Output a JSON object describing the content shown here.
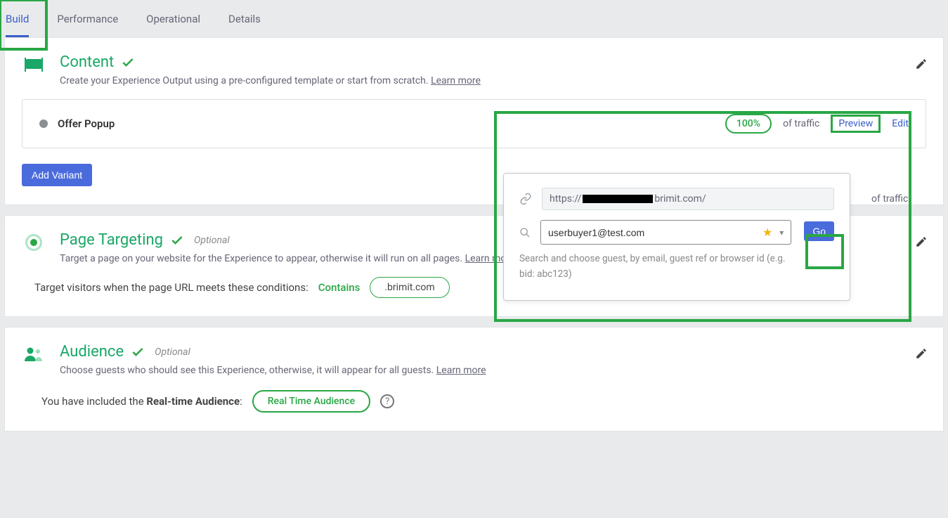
{
  "tabs": {
    "build": "Build",
    "performance": "Performance",
    "operational": "Operational",
    "details": "Details"
  },
  "content": {
    "title": "Content",
    "subtitle": "Create your Experience Output using a pre-configured template or start from scratch.",
    "learn_more": "Learn more",
    "variant_name": "Offer Popup",
    "traffic_pct": "100%",
    "of_traffic": "of traffic",
    "preview": "Preview",
    "edit": "Edit",
    "add_variant": "Add Variant"
  },
  "preview_popup": {
    "url_prefix": "https://",
    "url_suffix": "brimit.com/",
    "guest_value": "userbuyer1@test.com",
    "help_text": "Search and choose guest, by email, guest ref or browser id (e.g. bid: abc123)",
    "go": "Go"
  },
  "targeting": {
    "title": "Page Targeting",
    "optional": "Optional",
    "subtitle": "Target a page on your website for the Experience to appear, otherwise it will run on all pages.",
    "learn_more": "Learn more",
    "body_prefix": "Target visitors when the page URL meets these conditions:",
    "contains_label": "Contains",
    "contains_value": ".brimit.com"
  },
  "audience": {
    "title": "Audience",
    "optional": "Optional",
    "subtitle": "Choose guests who should see this Experience, otherwise, it will appear for all guests.",
    "learn_more": "Learn more",
    "body_prefix": "You have included the ",
    "body_bold": "Real-time Audience",
    "pill": "Real Time Audience"
  },
  "colors": {
    "accent_green": "#29a745",
    "accent_blue": "#4a6bdc",
    "link_blue": "#3a5ecc"
  }
}
